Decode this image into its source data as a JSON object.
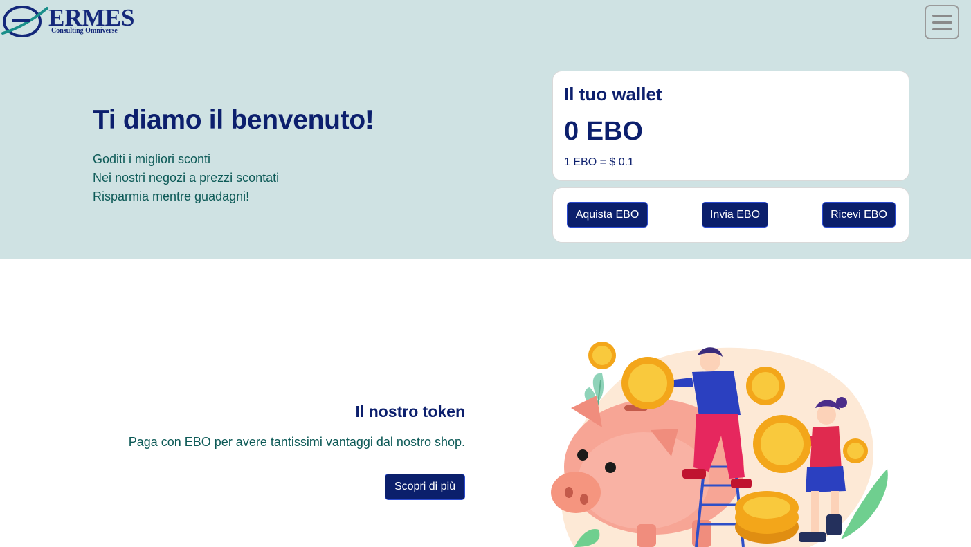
{
  "brand": {
    "name": "ERMES",
    "tagline": "Consulting Omniverse"
  },
  "header": {
    "menu_icon": "hamburger-menu-icon"
  },
  "welcome": {
    "title": "Ti diamo il benvenuto!",
    "lines": [
      "Goditi i migliori sconti",
      "Nei nostri negozi a prezzi scontati",
      "Risparmia mentre guadagni!"
    ]
  },
  "wallet": {
    "title": "Il tuo wallet",
    "balance": "0 EBO",
    "rate": "1 EBO = $ 0.1"
  },
  "actions": {
    "buy_label": "Aquista EBO",
    "send_label": "Invia EBO",
    "receive_label": "Ricevi EBO"
  },
  "token": {
    "title": "Il nostro token",
    "description": "Paga con EBO per avere tantissimi vantaggi dal nostro shop.",
    "more_label": "Scopri di più"
  },
  "illustration": {
    "icon": "piggy-bank-coins-illustration"
  },
  "colors": {
    "hero_bg": "#cfe2e3",
    "primary": "#0b1f6c",
    "text_teal": "#0d5a57",
    "coin": "#f5b22a",
    "piggy": "#f6a392"
  }
}
